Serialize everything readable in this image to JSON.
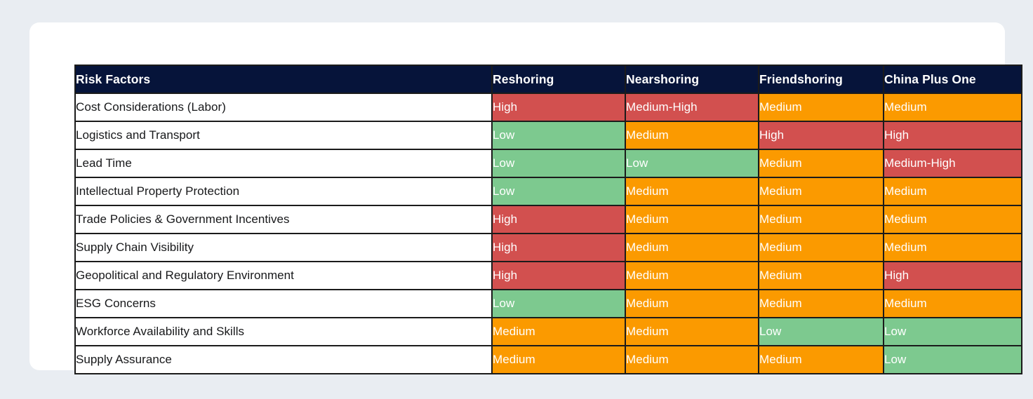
{
  "table": {
    "columns": [
      "Risk Factors",
      "Reshoring",
      "Nearshoring",
      "Friendshoring",
      "China Plus One"
    ],
    "rows": [
      {
        "factor": "Cost Considerations (Labor)",
        "reshoring": "High",
        "nearshoring": "Medium-High",
        "friendshoring": "Medium",
        "china_plus_one": "Medium"
      },
      {
        "factor": "Logistics and Transport",
        "reshoring": "Low",
        "nearshoring": "Medium",
        "friendshoring": "High",
        "china_plus_one": "High"
      },
      {
        "factor": "Lead Time",
        "reshoring": "Low",
        "nearshoring": "Low",
        "friendshoring": "Medium",
        "china_plus_one": "Medium-High"
      },
      {
        "factor": "Intellectual Property Protection",
        "reshoring": "Low",
        "nearshoring": "Medium",
        "friendshoring": "Medium",
        "china_plus_one": "Medium"
      },
      {
        "factor": "Trade Policies & Government Incentives",
        "reshoring": "High",
        "nearshoring": "Medium",
        "friendshoring": "Medium",
        "china_plus_one": "Medium"
      },
      {
        "factor": "Supply Chain Visibility",
        "reshoring": "High",
        "nearshoring": "Medium",
        "friendshoring": "Medium",
        "china_plus_one": "Medium"
      },
      {
        "factor": "Geopolitical and Regulatory Environment",
        "reshoring": "High",
        "nearshoring": "Medium",
        "friendshoring": "Medium",
        "china_plus_one": "High"
      },
      {
        "factor": "ESG Concerns",
        "reshoring": "Low",
        "nearshoring": "Medium",
        "friendshoring": "Medium",
        "china_plus_one": "Medium"
      },
      {
        "factor": "Workforce Availability and Skills",
        "reshoring": "Medium",
        "nearshoring": "Medium",
        "friendshoring": "Low",
        "china_plus_one": "Low"
      },
      {
        "factor": "Supply Assurance",
        "reshoring": "Medium",
        "nearshoring": "Medium",
        "friendshoring": "Medium",
        "china_plus_one": "Low"
      }
    ]
  },
  "colors": {
    "page_background": "#e9edf2",
    "card_background": "#ffffff",
    "header_background": "#06143a",
    "header_text": "#ffffff",
    "cell_border": "#1b1b1b",
    "rating_high": "#d2504f",
    "rating_medium_high": "#d2504f",
    "rating_medium": "#fb9a00",
    "rating_low": "#7dc98f",
    "rating_text": "#ffffff",
    "factor_text": "#17181a"
  }
}
